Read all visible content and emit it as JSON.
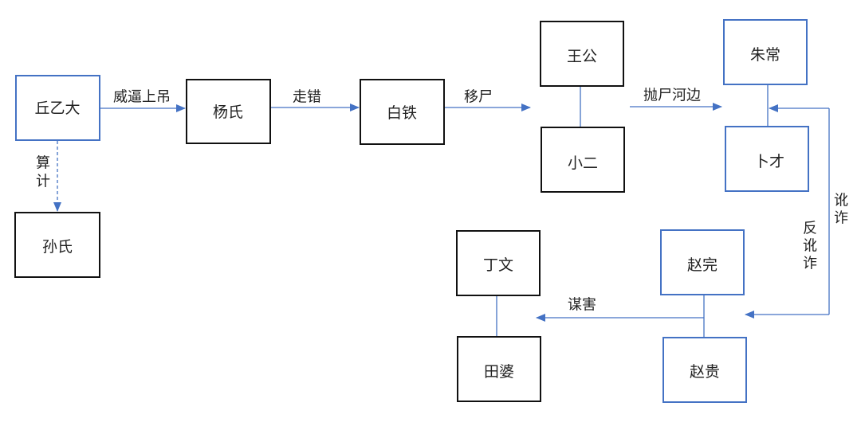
{
  "nodes": {
    "qiu_yida": "丘乙大",
    "yang_shi": "杨氏",
    "bai_tie": "白铁",
    "sun_shi": "孙氏",
    "wang_gong": "王公",
    "xiao_er": "小二",
    "zhu_chang": "朱常",
    "bu_cai": "卜才",
    "ding_wen": "丁文",
    "tian_po": "田婆",
    "zhao_wan": "赵完",
    "zhao_gui": "赵贵"
  },
  "edges": {
    "coerce_hang": "威逼上吊",
    "wrong_way": "走错",
    "move_body": "移尸",
    "scheme": [
      "算",
      "计"
    ],
    "dump_body": "抛尸河边",
    "extort": [
      "讹",
      "诈"
    ],
    "counter_extort": [
      "反",
      "讹",
      "诈"
    ],
    "murder": "谋害"
  },
  "colors": {
    "accent": "#4472c4",
    "box_border_black": "#111111"
  }
}
